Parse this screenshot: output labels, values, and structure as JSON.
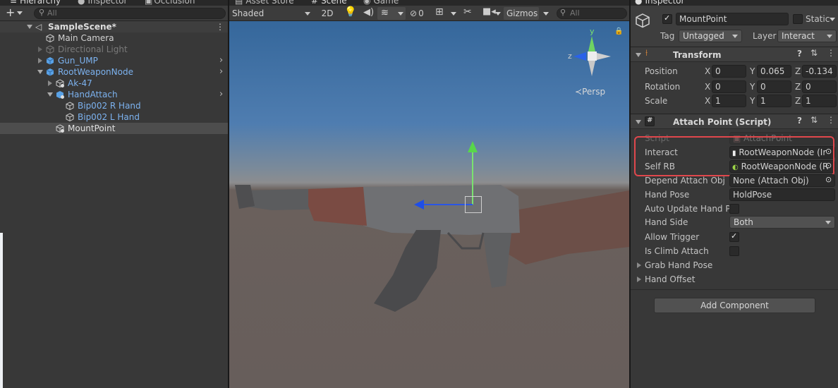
{
  "hierarchy": {
    "tabs": [
      "Hierarchy",
      "Inspector",
      "Occlusion"
    ],
    "search_placeholder": "All",
    "scene_name": "SampleScene*",
    "items": [
      {
        "label": "Main Camera"
      },
      {
        "label": "Directional Light"
      },
      {
        "label": "Gun_UMP"
      },
      {
        "label": "RootWeaponNode"
      },
      {
        "label": "Ak-47"
      },
      {
        "label": "HandAttach"
      },
      {
        "label": "Bip002 R Hand"
      },
      {
        "label": "Bip002 L Hand"
      },
      {
        "label": "MountPoint"
      }
    ]
  },
  "scene": {
    "tabs": [
      "Asset Store",
      "Scene",
      "Game"
    ],
    "shading_mode": "Shaded",
    "mode_2d": "2D",
    "hidden_count": "0",
    "gizmos_label": "Gizmos",
    "search_placeholder": "All",
    "persp_label": "Persp",
    "gizmo_axes": {
      "y": "y",
      "z": "z"
    }
  },
  "inspector": {
    "tab": "Inspector",
    "object_name": "MountPoint",
    "static_label": "Static",
    "tag_label": "Tag",
    "tag_value": "Untagged",
    "layer_label": "Layer",
    "layer_value": "Interact",
    "transform": {
      "title": "Transform",
      "rows": [
        {
          "label": "Position",
          "x": "0",
          "y": "0.065",
          "z": "-0.134"
        },
        {
          "label": "Rotation",
          "x": "0",
          "y": "0",
          "z": "0"
        },
        {
          "label": "Scale",
          "x": "1",
          "y": "1",
          "z": "1"
        }
      ],
      "axis": {
        "x": "X",
        "y": "Y",
        "z": "Z"
      }
    },
    "attach_point": {
      "title": "Attach Point (Script)",
      "script_label": "Script",
      "script_value": "AttachPoint",
      "interact_label": "Interact",
      "interact_value": "RootWeaponNode (Ir",
      "self_rb_label": "Self RB",
      "self_rb_value": "RootWeaponNode (R",
      "depend_label": "Depend Attach Obj",
      "depend_value": "None (Attach Obj)",
      "hand_pose_label": "Hand Pose",
      "hand_pose_value": "HoldPose",
      "auto_update_label": "Auto Update Hand Po",
      "hand_side_label": "Hand Side",
      "hand_side_value": "Both",
      "allow_trigger_label": "Allow Trigger",
      "climb_label": "Is Climb Attach",
      "grab_label": "Grab Hand Pose",
      "offset_label": "Hand Offset"
    },
    "add_component": "Add Component"
  },
  "colors": {
    "highlight": "#e0474c",
    "blue_label": "#7cb2ef",
    "sky": "#3e6c9e",
    "ground": "#675e5b"
  }
}
